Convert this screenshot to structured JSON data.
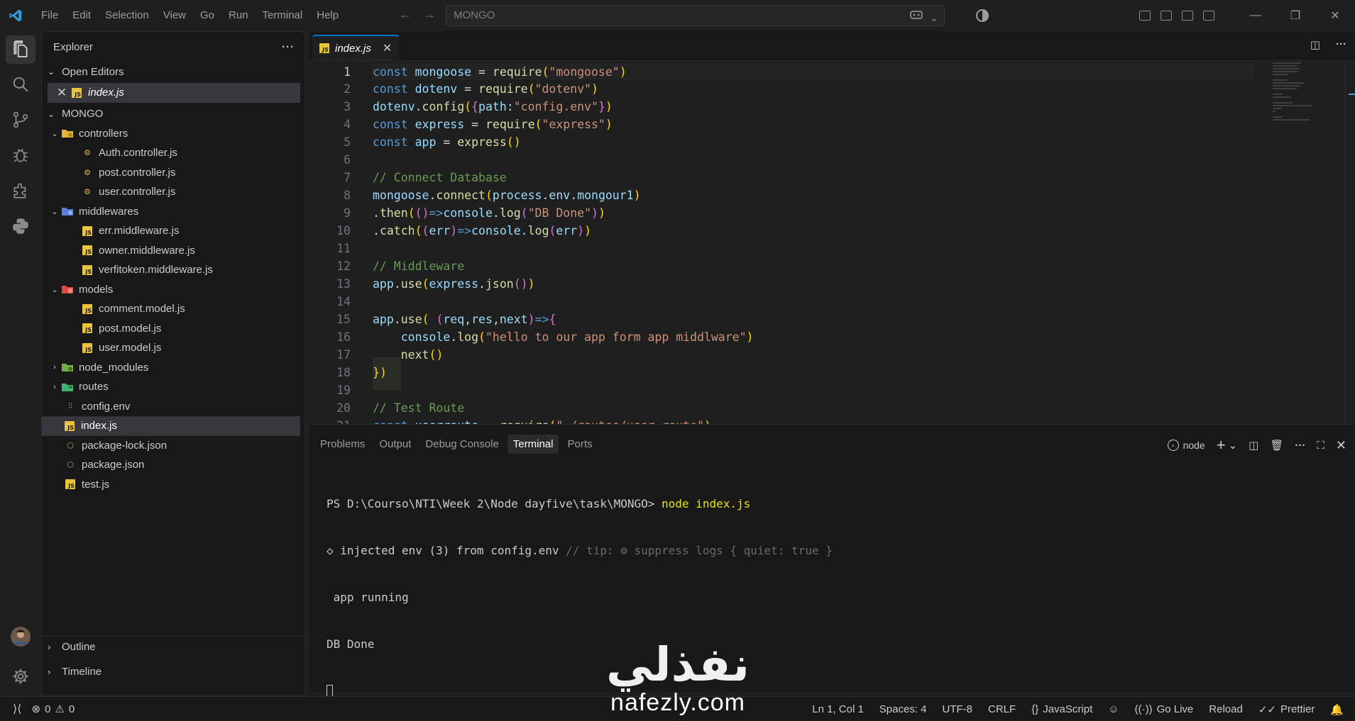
{
  "titlebar": {
    "menu": [
      "File",
      "Edit",
      "Selection",
      "View",
      "Go",
      "Run",
      "Terminal",
      "Help"
    ],
    "search_text": "MONGO"
  },
  "sidebar": {
    "header": "Explorer",
    "more": "···",
    "open_editors_label": "Open Editors",
    "open_editor_file": "index.js",
    "project_label": "MONGO",
    "tree": [
      {
        "label": "controllers",
        "type": "folder",
        "depth": 1,
        "open": true,
        "icon": "folder-controllers-icon"
      },
      {
        "label": "Auth.controller.js",
        "type": "gear",
        "depth": 2
      },
      {
        "label": "post.controller.js",
        "type": "gear",
        "depth": 2
      },
      {
        "label": "user.controller.js",
        "type": "gear",
        "depth": 2
      },
      {
        "label": "middlewares",
        "type": "folder",
        "depth": 1,
        "open": true,
        "icon": "folder-middlewares-icon"
      },
      {
        "label": "err.middleware.js",
        "type": "js",
        "depth": 2
      },
      {
        "label": "owner.middleware.js",
        "type": "js",
        "depth": 2
      },
      {
        "label": "verfitoken.middleware.js",
        "type": "js",
        "depth": 2
      },
      {
        "label": "models",
        "type": "folder",
        "depth": 1,
        "open": true,
        "icon": "folder-models-icon"
      },
      {
        "label": "comment.model.js",
        "type": "js",
        "depth": 2
      },
      {
        "label": "post.model.js",
        "type": "js",
        "depth": 2
      },
      {
        "label": "user.model.js",
        "type": "js",
        "depth": 2
      },
      {
        "label": "node_modules",
        "type": "folder",
        "depth": 1,
        "open": false,
        "icon": "folder-node-icon"
      },
      {
        "label": "routes",
        "type": "folder",
        "depth": 1,
        "open": false,
        "icon": "folder-routes-icon"
      },
      {
        "label": "config.env",
        "type": "env",
        "depth": 1
      },
      {
        "label": "index.js",
        "type": "js",
        "depth": 1,
        "selected": true
      },
      {
        "label": "package-lock.json",
        "type": "json",
        "depth": 1
      },
      {
        "label": "package.json",
        "type": "json",
        "depth": 1
      },
      {
        "label": "test.js",
        "type": "js",
        "depth": 1
      }
    ],
    "outline_label": "Outline",
    "timeline_label": "Timeline"
  },
  "editor": {
    "tab_label": "index.js",
    "current_line": 1,
    "lines": [
      "const mongoose = require(\"mongoose\")",
      "const dotenv = require(\"dotenv\")",
      "dotenv.config({path:\"config.env\"})",
      "const express = require(\"express\")",
      "const app = express()",
      "",
      "// Connect Database",
      "mongoose.connect(process.env.mongour1)",
      ".then(()=>console.log(\"DB Done\"))",
      ".catch((err)=>console.log(err))",
      "",
      "// Middleware",
      "app.use(express.json())",
      "",
      "app.use( (req,res,next)=>{",
      "    console.log(\"hello to our app form app middlware\")",
      "    next()",
      "})",
      "",
      "// Test Route",
      "const userroute = require(\"./routes/user.route\")"
    ]
  },
  "panel": {
    "tabs": [
      "Problems",
      "Output",
      "Debug Console",
      "Terminal",
      "Ports"
    ],
    "active_tab": "Terminal",
    "terminal_name": "node",
    "terminal_prompt": "PS D:\\Courso\\NTI\\Week 2\\Node dayfive\\task\\MONGO> ",
    "terminal_command": "node index.js",
    "terminal_line2_main": "◇ injected env (3) from config.env ",
    "terminal_line2_tip": "// tip: ⚙ suppress logs { quiet: true }",
    "terminal_line3": " app running",
    "terminal_line4": "DB Done"
  },
  "statusbar": {
    "errors": "0",
    "warnings": "0",
    "position": "Ln 1, Col 1",
    "spaces": "Spaces: 4",
    "encoding": "UTF-8",
    "eol": "CRLF",
    "language": "JavaScript",
    "golive": "Go Live",
    "reload": "Reload",
    "prettier": "Prettier"
  },
  "watermark": {
    "arabic": "نفذلي",
    "latin": "nafezly.com"
  },
  "colors": {
    "accent": "#0078d4",
    "js_badge": "#e8c33c",
    "json_icon": "#7ec06b",
    "gear_icon": "#e8b834",
    "keyword": "#569cd6",
    "string": "#ce9178",
    "comment": "#6a9955"
  }
}
